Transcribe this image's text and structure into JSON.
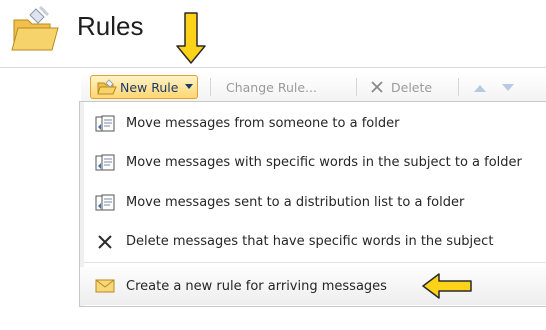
{
  "header": {
    "title": "Rules",
    "icons": {
      "folder": "folder-icon",
      "annotation_down": "arrow-down-annotation"
    }
  },
  "toolbar": {
    "new_rule_label": "New Rule",
    "change_rule_label": "Change Rule...",
    "delete_label": "Delete",
    "icons": [
      "new-rule-icon",
      "caret-down-icon",
      "delete-x-icon",
      "move-up-icon",
      "move-down-icon"
    ]
  },
  "menu": {
    "items": [
      {
        "label": "Move messages from someone to a folder",
        "icon": "rule-template-icon"
      },
      {
        "label": "Move messages with specific words in the subject to a folder",
        "icon": "rule-template-icon"
      },
      {
        "label": "Move messages sent to a distribution list to a folder",
        "icon": "rule-template-icon"
      },
      {
        "label": "Delete messages that have specific words in the subject",
        "icon": "delete-x-icon"
      },
      {
        "label": "Create a new rule for arriving messages",
        "icon": "envelope-icon"
      }
    ]
  },
  "colors": {
    "annotation_arrow": "#ffd21a",
    "new_rule_bg": "#ffd672",
    "new_rule_border": "#e0a232",
    "title_text": "#1f1f1f"
  }
}
